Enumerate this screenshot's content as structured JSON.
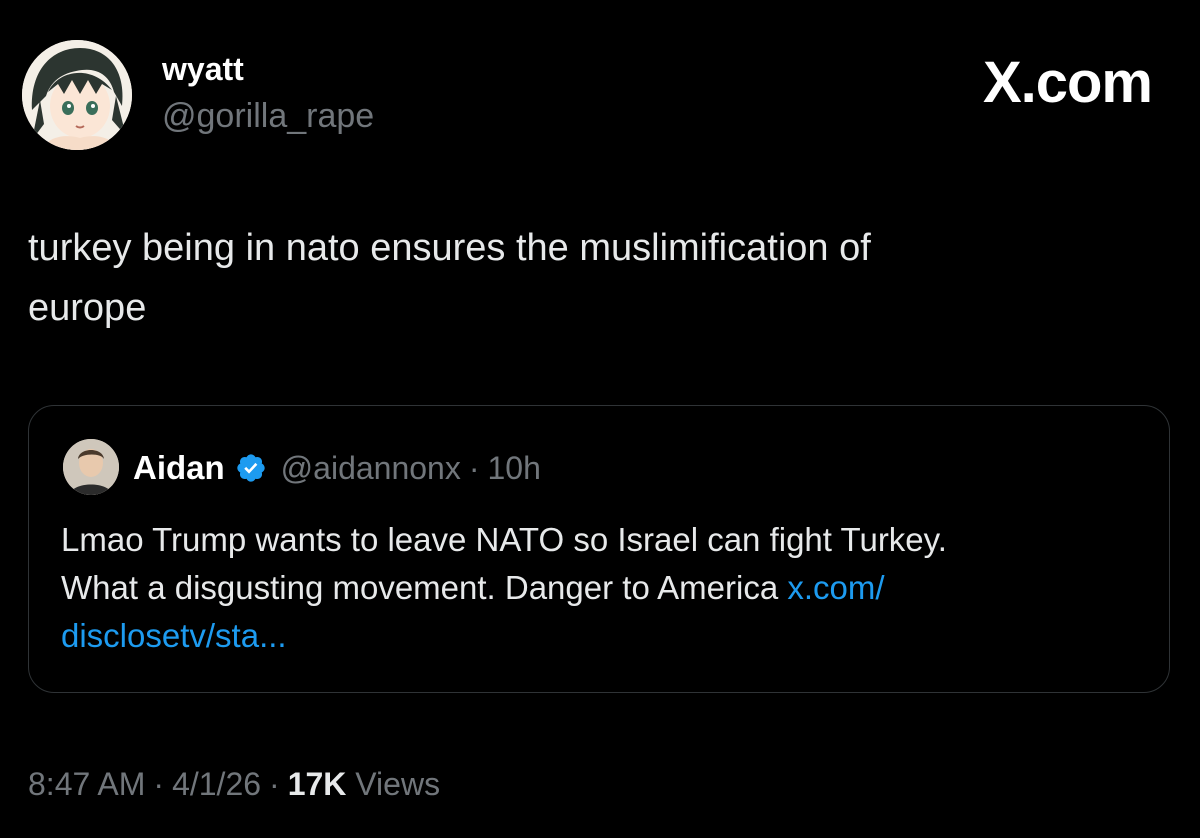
{
  "header": {
    "display_name": "wyatt",
    "handle": "@gorilla_rape",
    "brand": "X.com"
  },
  "tweet": {
    "text_line1": "turkey being in nato ensures the muslimification of",
    "text_line2": "europe"
  },
  "quote": {
    "name": "Aidan",
    "handle": "@aidannonx",
    "separator": "·",
    "time": "10h",
    "text_line1": "Lmao Trump wants to leave NATO so Israel can fight Turkey.",
    "text_line2": "What a disgusting movement. Danger to America ",
    "link_part1": "x.com/",
    "link_part2": "disclosetv/sta...",
    "verified_icon": "verified-badge-icon"
  },
  "meta": {
    "time": "8:47 AM",
    "separator": "·",
    "date": "4/1/26",
    "views_count": "17K",
    "views_label": "Views"
  },
  "colors": {
    "background": "#000000",
    "text_primary": "#e7e9ea",
    "text_secondary": "#71767b",
    "link": "#1d9bf0",
    "verified": "#1d9bf0",
    "border": "#2f3336"
  }
}
